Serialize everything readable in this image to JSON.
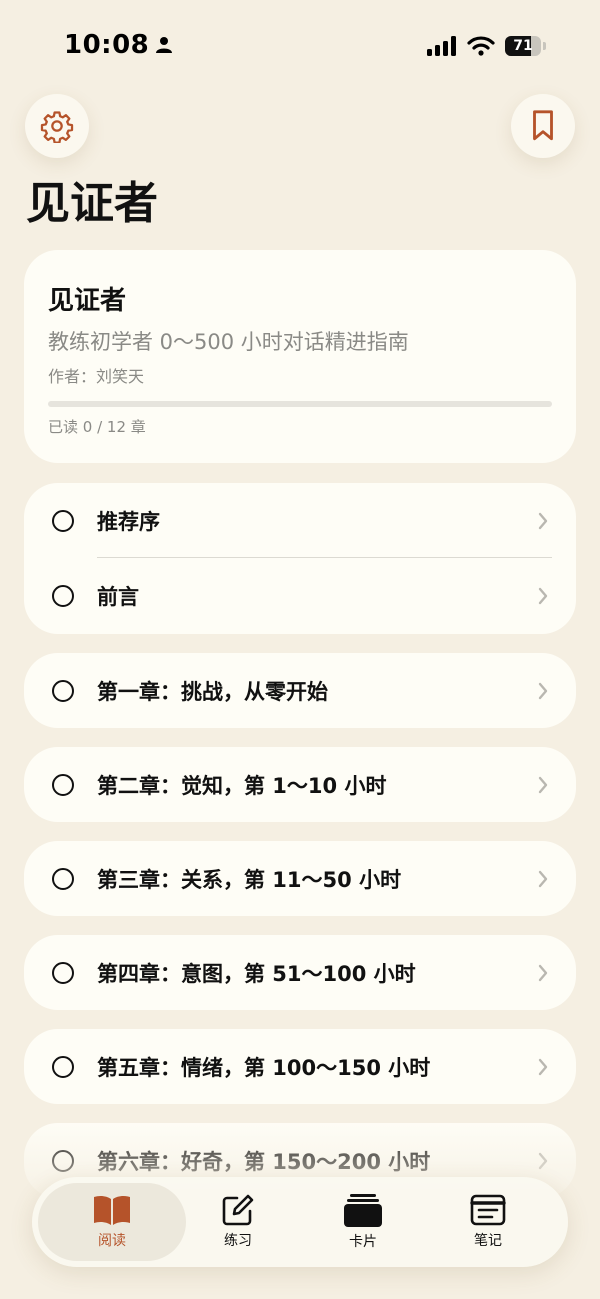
{
  "status_bar": {
    "time": "10:08",
    "battery": "71",
    "battery_level": 0.71
  },
  "header": {
    "title": "见证者"
  },
  "book": {
    "title": "见证者",
    "subtitle": "教练初学者 0～500 小时对话精进指南",
    "author": "作者：刘笑天",
    "progress_text": "已读 0 / 12 章",
    "progress_fraction": 0
  },
  "front_matter": [
    {
      "label": "推荐序"
    },
    {
      "label": "前言"
    }
  ],
  "chapters": [
    {
      "label": "第一章：挑战，从零开始"
    },
    {
      "label": "第二章：觉知，第 1～10 小时"
    },
    {
      "label": "第三章：关系，第 11～50 小时"
    },
    {
      "label": "第四章：意图，第 51～100 小时"
    },
    {
      "label": "第五章：情绪，第 100～150 小时"
    },
    {
      "label": "第六章：好奇，第 150～200 小时"
    }
  ],
  "tabs": [
    {
      "label": "阅读",
      "icon": "open-book-icon",
      "active": true
    },
    {
      "label": "练习",
      "icon": "edit-square-icon",
      "active": false
    },
    {
      "label": "卡片",
      "icon": "card-stack-icon",
      "active": false
    },
    {
      "label": "笔记",
      "icon": "note-icon",
      "active": false
    }
  ],
  "colors": {
    "background": "#f5efe2",
    "card": "#fefdf6",
    "accent": "#b5532a",
    "muted_text": "#8a8a86"
  }
}
